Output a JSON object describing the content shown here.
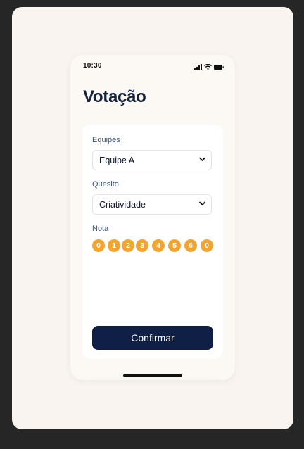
{
  "status_bar": {
    "time": "10:30"
  },
  "screen": {
    "title": "Votação"
  },
  "form": {
    "team": {
      "label": "Equipes",
      "value": "Equipe A"
    },
    "criterion": {
      "label": "Quesito",
      "value": "Criatividade"
    },
    "score": {
      "label": "Nota",
      "options": [
        "0",
        "1",
        "2",
        "3",
        "4",
        "5",
        "6",
        "0"
      ]
    },
    "confirm_label": "Confirmar"
  },
  "colors": {
    "accent": "#f0a432",
    "primary": "#0f1f45",
    "title": "#14213d",
    "label": "#3c5078"
  }
}
